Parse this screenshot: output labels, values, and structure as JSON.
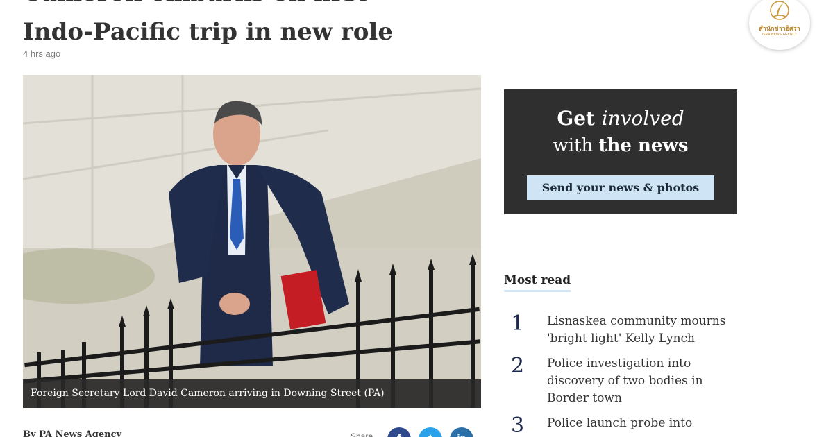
{
  "article": {
    "headline_line1": "Cameron embarks on first",
    "headline_line2": "Indo-Pacific trip in new role",
    "timestamp": "4 hrs ago",
    "photo_caption": "Foreign Secretary Lord David Cameron arriving in Downing Street (PA)",
    "byline": "By PA News Agency"
  },
  "share": {
    "label": "Share",
    "buttons": [
      {
        "icon": "facebook-icon",
        "glyph": "f",
        "color": "#2f4a8c"
      },
      {
        "icon": "twitter-icon",
        "glyph": "t",
        "color": "#2aa1e8"
      },
      {
        "icon": "linkedin-icon",
        "glyph": "in",
        "color": "#2a6fa8"
      }
    ]
  },
  "promo": {
    "line1_a": "Get ",
    "line1_b": "involved",
    "line2_a": "with ",
    "line2_b": "the news",
    "button_label": "Send your news & photos"
  },
  "most_read": {
    "title": "Most read",
    "items": [
      {
        "rank": "1",
        "text": "Lisnaskea community mourns 'bright light' Kelly Lynch"
      },
      {
        "rank": "2",
        "text": "Police investigation into discovery of two bodies in Border town"
      },
      {
        "rank": "3",
        "text": "Police launch probe into"
      }
    ]
  },
  "logo": {
    "name": "สำนักข่าวอิศรา",
    "subtitle": "ISRA NEWS AGENCY"
  },
  "colors": {
    "promo_bg": "#2f2f2f",
    "accent": "#cfe5f5",
    "rank_color": "#1f2a50"
  }
}
